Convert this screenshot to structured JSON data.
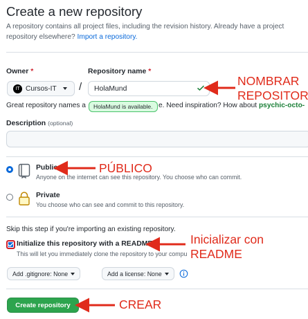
{
  "header": {
    "title": "Create a new repository",
    "lead_text": "A repository contains all project files, including the revision history. Already have a project repository elsewhere?",
    "import_link": "Import a repository."
  },
  "owner": {
    "label": "Owner",
    "required_mark": "*",
    "value": "Cursos-IT",
    "avatar_text": "IT"
  },
  "repo_name": {
    "label": "Repository name",
    "required_mark": "*",
    "value": "HolaMund",
    "tooltip": "HolaMund is available.",
    "slash": "/"
  },
  "hint": {
    "prefix": "Great repository names a",
    "middle": "e. Need inspiration? How about",
    "suggestion": "psychic-octo-"
  },
  "description": {
    "label": "Description",
    "optional": "(optional)"
  },
  "visibility": {
    "public_title": "Public",
    "public_desc": "Anyone on the internet can see this repository. You choose who can commit.",
    "private_title": "Private",
    "private_desc": "You choose who can see and commit to this repository."
  },
  "init": {
    "skip_text": "Skip this step if you're importing an existing repository.",
    "readme_label": "Initialize this repository with a README",
    "readme_desc": "This will let you immediately clone the repository to your compu",
    "gitignore_btn": "Add .gitignore: None",
    "license_btn": "Add a license: None"
  },
  "actions": {
    "create_label": "Create repository"
  },
  "annotations": {
    "nombrar_line1": "NOMBRAR",
    "nombrar_line2": "REPOSITORIO",
    "publico": "PÚBLICO",
    "readme_line1": "Inicializar con",
    "readme_line2": "README",
    "crear": "CREAR",
    "color": "#e02b1b"
  },
  "colors": {
    "link": "#0969da",
    "primary_button": "#2da44e",
    "required": "#cf222e",
    "success": "#1a7f37"
  }
}
